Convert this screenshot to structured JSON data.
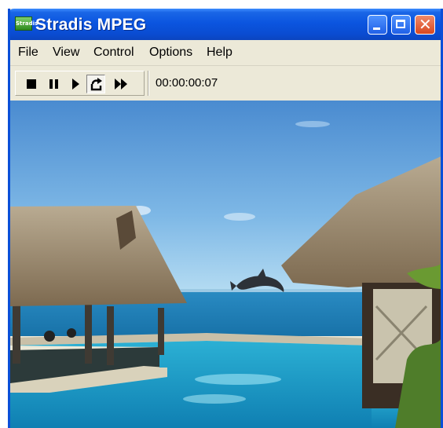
{
  "window": {
    "title": "Stradis MPEG",
    "icon": "stradis-app-icon",
    "icon_text": "Stradis",
    "controls": [
      "minimize-icon",
      "maximize-icon",
      "close-icon"
    ],
    "close_glyph": "✕"
  },
  "menu": {
    "items": [
      "File",
      "View",
      "Control",
      "Options",
      "Help"
    ]
  },
  "toolbar": {
    "buttons": [
      "stop-icon",
      "pause-icon",
      "play-icon",
      "loop-icon",
      "fast-forward-icon"
    ],
    "pressed": "loop-icon",
    "time": "00:00:00:07"
  },
  "video": {
    "scene": "dolphin-over-tropical-lagoon"
  },
  "colors": {
    "titlebar": "#0b55e0",
    "close": "#d9481f",
    "window_bg": "#ece9d8",
    "sky": "#5b9ad8",
    "sea": "#1f8fc0"
  }
}
